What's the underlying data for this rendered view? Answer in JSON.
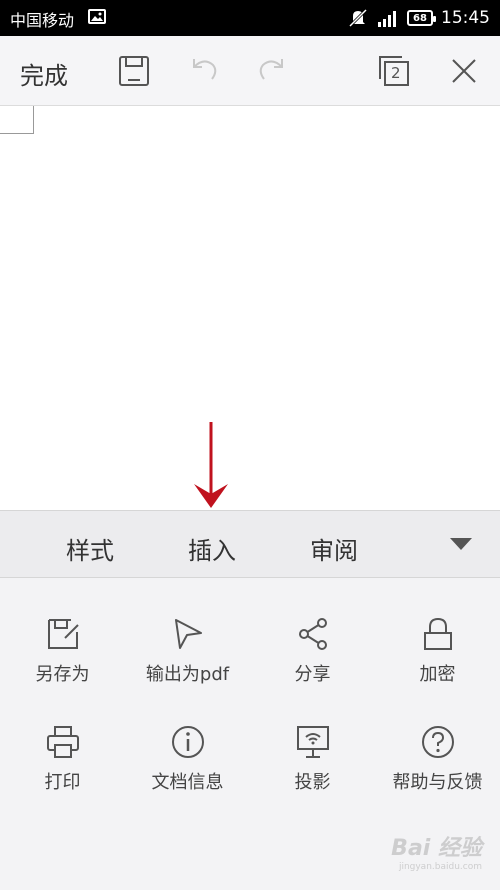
{
  "status_bar": {
    "carrier": "中国移动",
    "battery": "68",
    "time": "15:45"
  },
  "toolbar": {
    "done_label": "完成",
    "window_count": "2",
    "icons": [
      "save-icon",
      "undo-icon",
      "redo-icon",
      "window-switch-icon",
      "close-icon"
    ]
  },
  "tabs": [
    {
      "label": "样式"
    },
    {
      "label": "插入"
    },
    {
      "label": "审阅"
    }
  ],
  "menu": {
    "items": [
      {
        "label": "另存为",
        "icon": "save-as-icon"
      },
      {
        "label": "输出为pdf",
        "icon": "export-pdf-icon"
      },
      {
        "label": "分享",
        "icon": "share-icon"
      },
      {
        "label": "加密",
        "icon": "lock-icon"
      },
      {
        "label": "打印",
        "icon": "printer-icon"
      },
      {
        "label": "文档信息",
        "icon": "info-icon"
      },
      {
        "label": "投影",
        "icon": "projection-icon"
      },
      {
        "label": "帮助与反馈",
        "icon": "help-icon"
      }
    ]
  },
  "watermark": {
    "text": "Bai 经验",
    "url_text": "jingyan.baidu.com"
  },
  "colors": {
    "annotation_arrow": "#c0121e",
    "icon_gray": "#555555",
    "icon_disabled": "#c8c8c8"
  }
}
